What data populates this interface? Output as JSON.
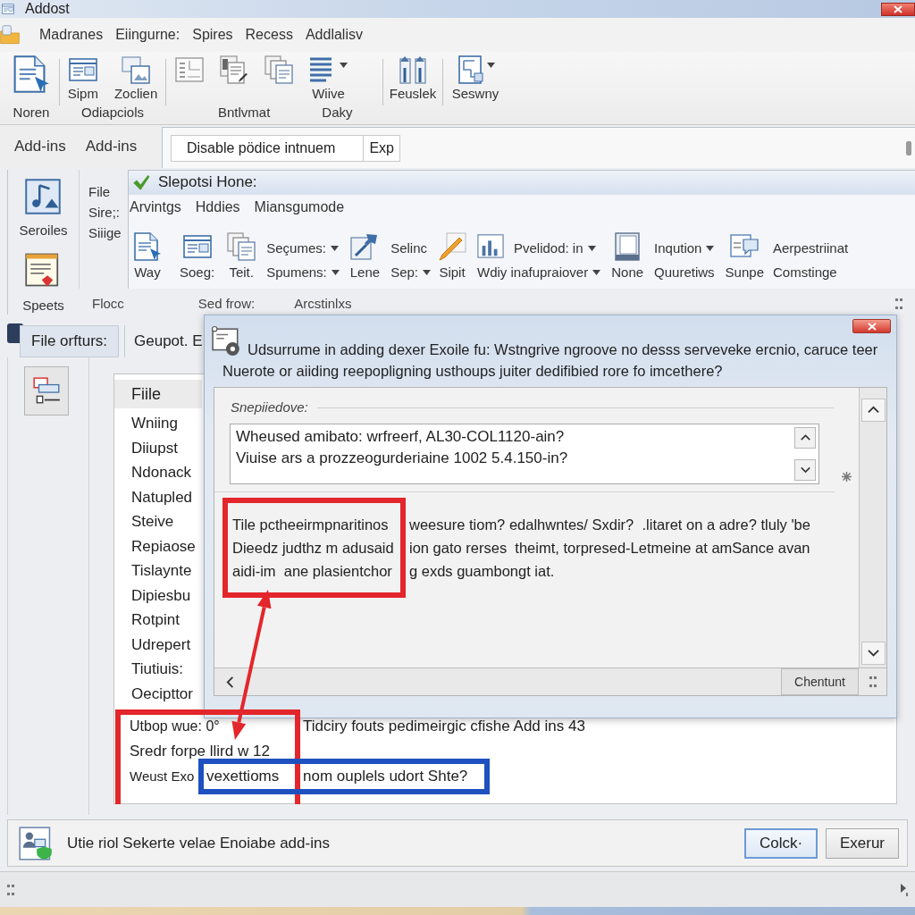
{
  "window": {
    "title": "Addost"
  },
  "menu": {
    "tabs": [
      "Madranes",
      "Eiingurne:",
      "Spires",
      "Recess",
      "Addlalisv"
    ]
  },
  "ribbon": {
    "groups": [
      {
        "labels": [
          "Noren"
        ],
        "items": [
          {
            "dropdown": false
          }
        ]
      },
      {
        "labels": [
          "Odiapciols"
        ],
        "items": [
          {
            "label": "Sipm",
            "dropdown": false
          },
          {
            "label": "Zoclien",
            "dropdown": false
          }
        ]
      },
      {
        "labels": [
          "Bntlvmat",
          "Daky"
        ],
        "items": [
          {
            "dropdown": false
          },
          {
            "dropdown": false
          },
          {
            "dropdown": false
          },
          {
            "label": "Wiive",
            "dropdown": true
          }
        ]
      },
      {
        "items": [
          {
            "label": "Feuslek",
            "dropdown": false
          }
        ]
      },
      {
        "items": [
          {
            "label": "Seswny",
            "dropdown": true
          }
        ]
      }
    ]
  },
  "toolbar": {
    "tabs": [
      "Add-ins",
      "Add-ins"
    ],
    "field": {
      "value": "Disable pödice intnuem",
      "button": "Exp"
    }
  },
  "side_panel": {
    "buttons": [
      "Seroiles",
      "Speets"
    ],
    "links": [
      "File",
      "Sire;:",
      "Siiige"
    ]
  },
  "inner_window": {
    "title": "Slepotsi Hone:",
    "tabs": [
      "Arvintgs",
      "Hddies",
      "Miansgumode"
    ],
    "commands": [
      {
        "kind": "large",
        "label": "Way"
      },
      {
        "kind": "large",
        "label": "Soeg:"
      },
      {
        "kind": "large",
        "label": "Teit."
      },
      {
        "kind": "stack",
        "rows": [
          {
            "label": "Seçumes:",
            "dropdown": true
          },
          {
            "label": "Spumens:",
            "dropdown": true
          }
        ]
      },
      {
        "kind": "large",
        "label": "Lene"
      },
      {
        "kind": "stack",
        "rows": [
          {
            "label": "Selinc",
            "dropdown": false
          },
          {
            "label": "Sep:",
            "dropdown": true
          }
        ]
      },
      {
        "kind": "large",
        "label": "Sipit"
      },
      {
        "kind": "stack_icon",
        "rows": [
          {
            "label": "Pvelidod: in",
            "dropdown": true
          },
          {
            "label": "Wdiy inafupraiover",
            "dropdown": true
          }
        ]
      },
      {
        "kind": "large",
        "label": "None"
      },
      {
        "kind": "stack",
        "rows": [
          {
            "label": "Inqution",
            "dropdown": true
          },
          {
            "label": "Quuretiws",
            "dropdown": false
          }
        ]
      },
      {
        "kind": "large",
        "label": "Sunpe"
      },
      {
        "kind": "stack",
        "rows": [
          {
            "label": "Aerpestriinat",
            "dropdown": false
          },
          {
            "label": "Comstinge",
            "dropdown": false
          }
        ]
      }
    ],
    "group_labels": [
      "Flocc",
      "Sed frow:",
      "Arcstinlxs"
    ]
  },
  "lower_panel": {
    "tabs": [
      {
        "label": "File orfturs:",
        "selected": true
      },
      {
        "label": "Geupot. E",
        "selected": false
      }
    ],
    "list": {
      "items": [
        {
          "label": "Fiile",
          "selected": true
        },
        {
          "label": "Wniing",
          "selected": false
        },
        {
          "label": "Diiupst",
          "selected": false
        },
        {
          "label": "Ndonack",
          "selected": false
        },
        {
          "label": "Natupled",
          "selected": false
        },
        {
          "label": "Steive",
          "selected": false
        },
        {
          "label": "Repiaose",
          "selected": false
        },
        {
          "label": "Tislaynte",
          "selected": false
        },
        {
          "label": "Dipiesbu",
          "selected": false
        },
        {
          "label": "Rotpint",
          "selected": false
        },
        {
          "label": "Udrepert",
          "selected": false
        },
        {
          "label": "Tiutiuis:",
          "selected": false
        },
        {
          "label": "Oecipttor",
          "selected": false
        }
      ]
    },
    "notes": [
      {
        "parts": [
          "Utbop wue: 0°",
          "Tidciry fouts pedimeirgic cfishe Add ins 43"
        ]
      },
      {
        "parts": [
          "Sredr forpe llird w 12"
        ]
      },
      {
        "parts": [
          "Weust Exo",
          "vexettioms",
          "nom ouplels udort Shte?"
        ]
      }
    ]
  },
  "dialog": {
    "title": "Udsurrume in adding dexer Exoile fu: Wstngrive ngroove no desss serveveke ercnio, caruce teer",
    "prompt": "Nuerote or aiiding reepopligning usthoups juiter dedifibied rore fo imcethere?",
    "group_label": "Snepiiedove:",
    "field_lines": [
      "Wheused amibato: wrfreerf, AL30-COL1120-ain?",
      "Viuise ars a prozzeogurderiaine 1002 5.4.150-in?"
    ],
    "paragraph": [
      [
        "Tile pctheeirmpnaritinos",
        "weesure tiom? edalhwntes/ Sxdir?  .litaret on a adre? tluly 'be"
      ],
      [
        "Dieedz judthz m adusaid",
        "ion gato rerses  theimt, torpresed-Letmeine at amSance avan"
      ],
      [
        "aidi-im  ane plasientchor",
        "g exds guambongt iat."
      ]
    ],
    "button": "Chentunt"
  },
  "footer": {
    "text": "Utie riol Sekerte velae Enoiabe add-ins",
    "buttons": [
      {
        "label": "Colck·",
        "default": true
      },
      {
        "label": "Exerur",
        "default": false
      }
    ]
  },
  "annotations": [
    {
      "kind": "box",
      "color": "#e3262b"
    },
    {
      "kind": "arrow",
      "color": "#e3262b"
    },
    {
      "kind": "box",
      "color": "#e3262b"
    },
    {
      "kind": "box",
      "color": "#1e50c0"
    }
  ]
}
